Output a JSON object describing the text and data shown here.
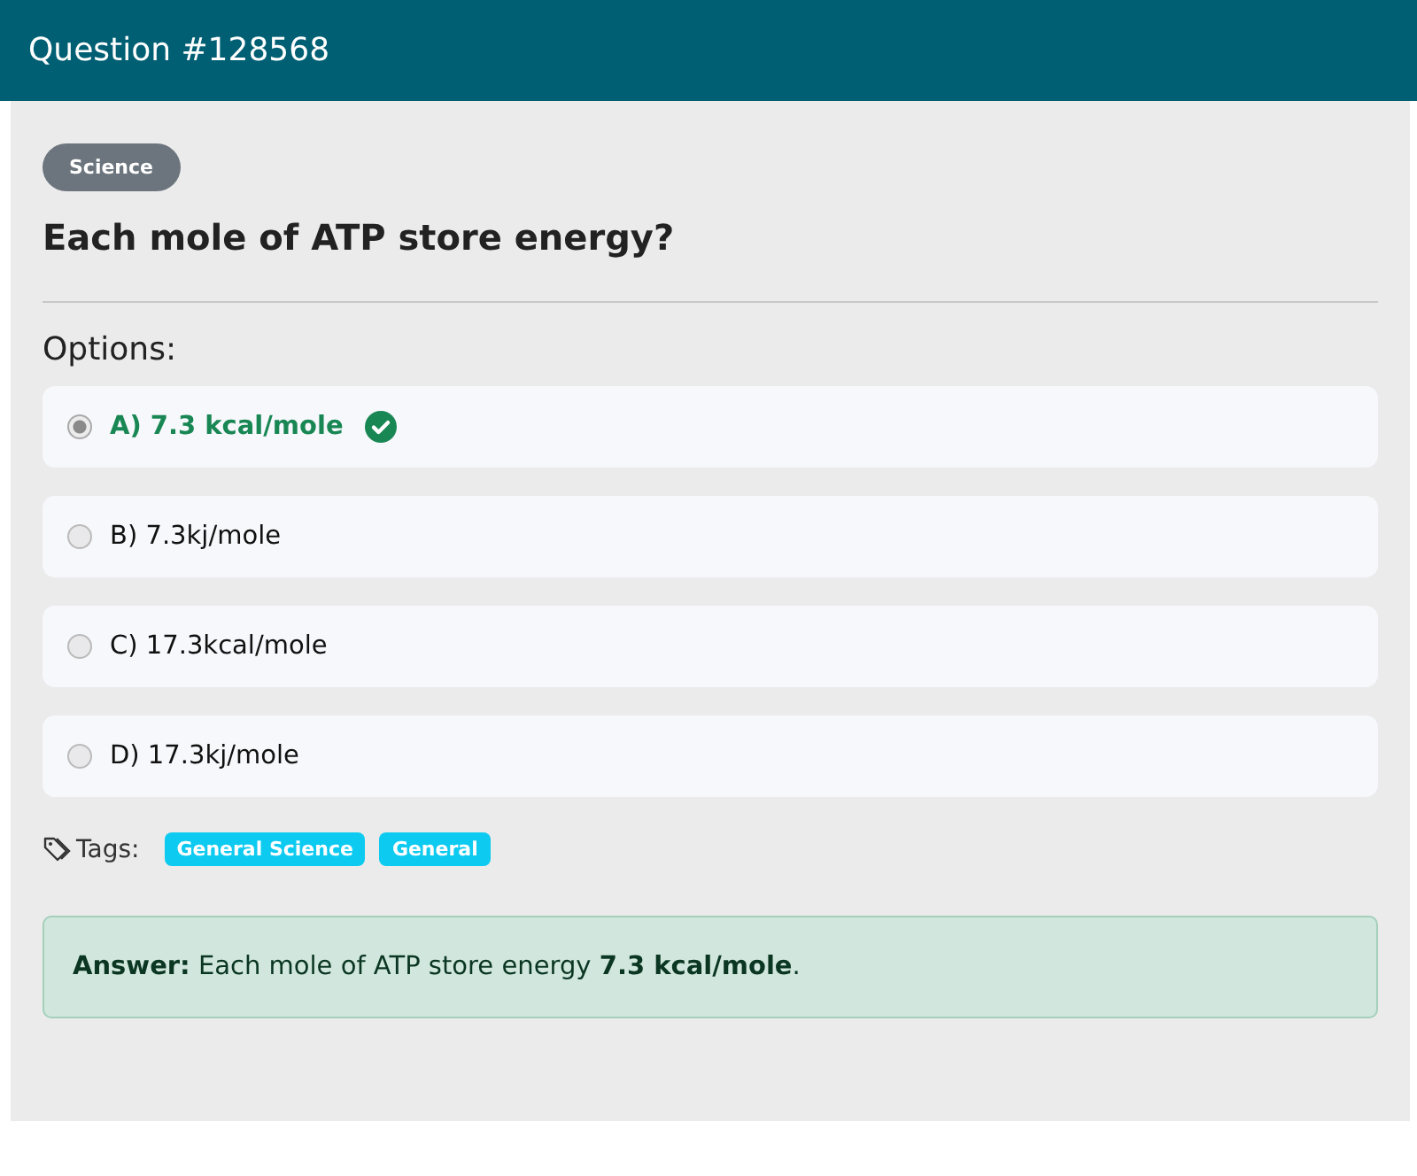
{
  "header": {
    "title": "Question #128568"
  },
  "category": "Science",
  "question": "Each mole of ATP store energy?",
  "options_label": "Options:",
  "options": [
    {
      "text": "A) 7.3 kcal/mole",
      "selected": true,
      "correct": true
    },
    {
      "text": "B) 7.3kj/mole",
      "selected": false,
      "correct": false
    },
    {
      "text": "C) 17.3kcal/mole",
      "selected": false,
      "correct": false
    },
    {
      "text": "D) 17.3kj/mole",
      "selected": false,
      "correct": false
    }
  ],
  "tags_label": "Tags:",
  "tags": [
    "General Science",
    "General"
  ],
  "answer": "**Answer:** Each mole of ATP store energy **7.3 kcal/mole**."
}
